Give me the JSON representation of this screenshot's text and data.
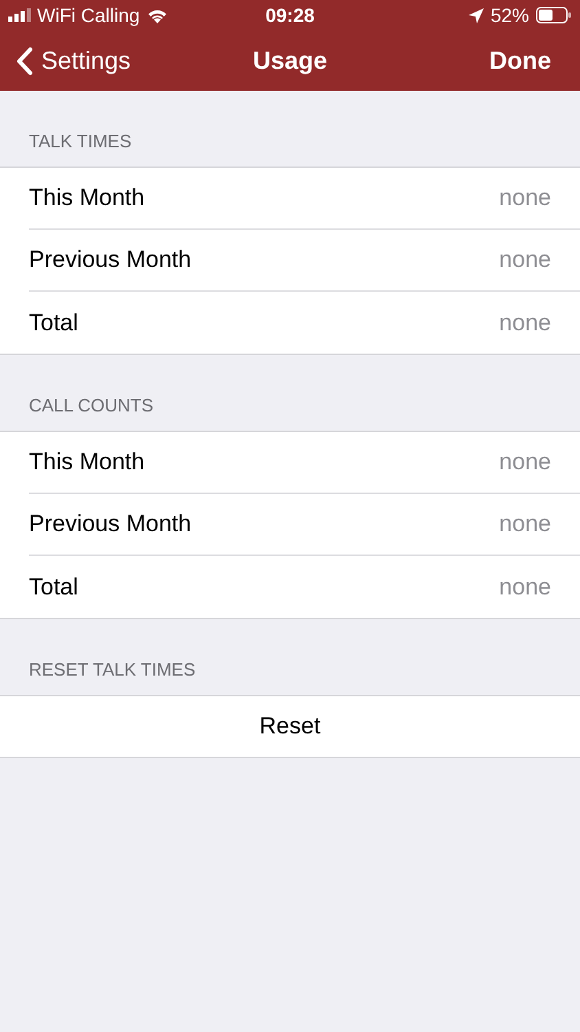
{
  "status_bar": {
    "carrier": "WiFi Calling",
    "time": "09:28",
    "battery": "52%"
  },
  "nav_bar": {
    "back": "Settings",
    "title": "Usage",
    "action": "Done"
  },
  "sections": [
    {
      "header": "TALK TIMES",
      "rows": [
        {
          "label": "This Month",
          "value": "none"
        },
        {
          "label": "Previous Month",
          "value": "none"
        },
        {
          "label": "Total",
          "value": "none"
        }
      ]
    },
    {
      "header": "CALL COUNTS",
      "rows": [
        {
          "label": "This Month",
          "value": "none"
        },
        {
          "label": "Previous Month",
          "value": "none"
        },
        {
          "label": "Total",
          "value": "none"
        }
      ]
    },
    {
      "header": "RESET TALK TIMES",
      "button": "Reset"
    }
  ]
}
